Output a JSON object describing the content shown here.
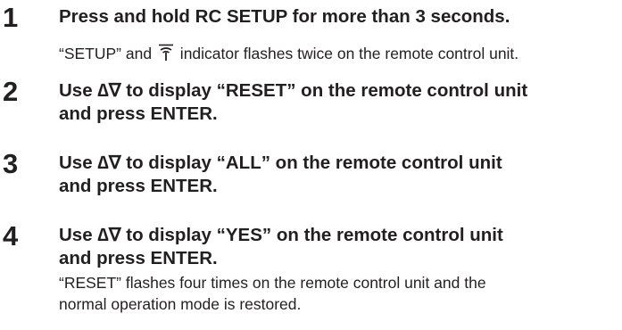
{
  "steps": [
    {
      "number": "1",
      "title_lines": [
        "Press and hold RC SETUP for more than 3 seconds."
      ],
      "desc_before_icon": "“SETUP” and ",
      "desc_icon": "remote-indicator-icon",
      "desc_after_icon": " indicator flashes twice on the remote control unit."
    },
    {
      "number": "2",
      "title_lines": [
        "Use ∆∇ to display “RESET” on the remote control unit",
        "and press ENTER."
      ]
    },
    {
      "number": "3",
      "title_lines": [
        "Use ∆∇ to display “ALL” on the remote control unit",
        "and press ENTER."
      ]
    },
    {
      "number": "4",
      "title_lines": [
        "Use ∆∇ to display “YES” on the remote control unit",
        "and press ENTER."
      ],
      "desc_lines": [
        "“RESET” flashes four times on the remote control unit and the",
        "normal operation mode is restored."
      ]
    }
  ]
}
